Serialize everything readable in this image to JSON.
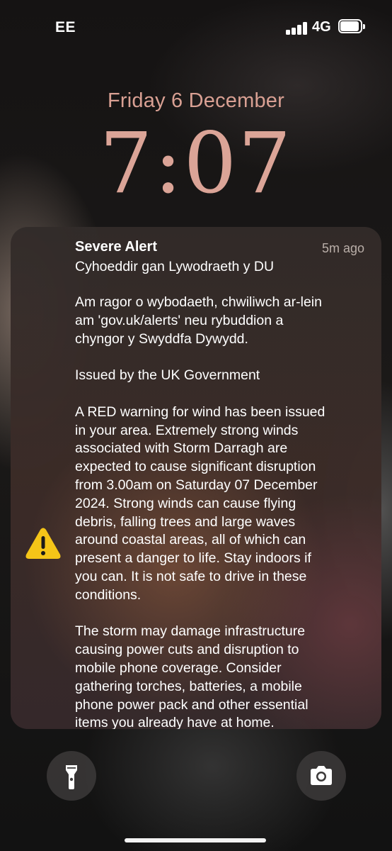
{
  "status_bar": {
    "carrier": "EE",
    "network": "4G",
    "signal_bars": 4,
    "battery_level": 1.0
  },
  "lock_screen": {
    "date": "Friday 6 December",
    "time": "7:07"
  },
  "notification": {
    "title": "Severe Alert",
    "time_ago": "5m ago",
    "subtitle": "Cyhoeddir gan Lywodraeth y DU",
    "icon": "warning-triangle-icon",
    "paragraphs": [
      "Am ragor o wybodaeth, chwiliwch ar-lein\nam 'gov.uk/alerts' neu rybuddion a\nchyngor y Swyddfa Dywydd.",
      "Issued by the UK Government",
      "A RED warning for wind has been issued\nin your area. Extremely strong winds\nassociated with Storm Darragh are\nexpected to cause significant disruption\nfrom 3.00am on Saturday 07 December\n2024. Strong winds can cause flying\ndebris, falling trees and large waves\naround coastal areas, all of which can\npresent a danger to life. Stay indoors if\nyou can. It is not safe to drive in these\nconditions.",
      "The storm may damage infrastructure\ncausing power cuts and disruption to\nmobile phone coverage. Consider\ngathering torches, batteries, a mobile\nphone power pack and other essential\nitems you already have at home."
    ]
  },
  "controls": {
    "left_icon": "flashlight-icon",
    "right_icon": "camera-icon"
  },
  "colors": {
    "clock": "#dba497",
    "alert_icon": "#f5c518"
  }
}
